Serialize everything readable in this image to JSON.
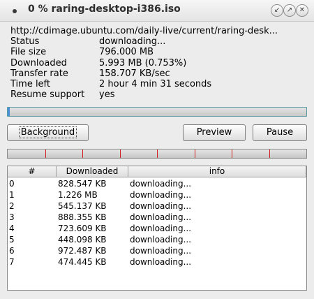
{
  "window": {
    "title": "0 % raring-desktop-i386.iso",
    "minimize_icon": "minimize-icon",
    "maximize_icon": "maximize-icon",
    "close_icon": "close-icon"
  },
  "info": {
    "url": "http://cdimage.ubuntu.com/daily-live/current/raring-desk...",
    "rows": [
      {
        "key": "Status",
        "value": "downloading..."
      },
      {
        "key": "File size",
        "value": "796.000 MB"
      },
      {
        "key": "Downloaded",
        "value": "5.993 MB (0.753%)"
      },
      {
        "key": "Transfer rate",
        "value": "158.707 KB/sec"
      },
      {
        "key": "Time left",
        "value": "2 hour 4 min 31 seconds"
      },
      {
        "key": "Resume support",
        "value": "yes"
      }
    ]
  },
  "overall_progress": 0.00753,
  "buttons": {
    "background": "Background",
    "preview": "Preview",
    "pause": "Pause"
  },
  "segments": {
    "count": 8
  },
  "table": {
    "headers": [
      "#",
      "Downloaded",
      "info"
    ],
    "rows": [
      [
        "0",
        "828.547 KB",
        "downloading..."
      ],
      [
        "1",
        "1.226 MB",
        "downloading..."
      ],
      [
        "2",
        "545.137 KB",
        "downloading..."
      ],
      [
        "3",
        "888.355 KB",
        "downloading..."
      ],
      [
        "4",
        "723.609 KB",
        "downloading..."
      ],
      [
        "5",
        "448.098 KB",
        "downloading..."
      ],
      [
        "6",
        "972.487 KB",
        "downloading..."
      ],
      [
        "7",
        "474.445 KB",
        "downloading..."
      ]
    ]
  }
}
